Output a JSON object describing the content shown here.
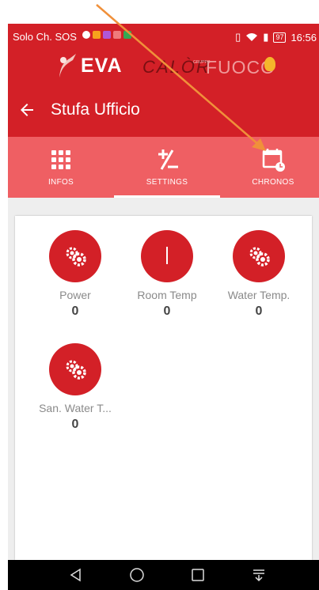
{
  "status": {
    "carrier": "Solo Ch. SOS",
    "battery": "97",
    "time": "16:56"
  },
  "brand": {
    "name_left": "EVA",
    "name_mid": "CALÒR",
    "name_tiny": "GRUPPO",
    "name_right": "FUOCO"
  },
  "header": {
    "title": "Stufa Ufficio",
    "back_icon": "arrow-left"
  },
  "tabs": [
    {
      "label": "INFOS",
      "icon": "grid-dots-icon",
      "selected": false
    },
    {
      "label": "SETTINGS",
      "icon": "plus-minus-icon",
      "selected": true
    },
    {
      "label": "CHRONOS",
      "icon": "calendar-clock-icon",
      "selected": false
    }
  ],
  "tiles": [
    {
      "name": "Power",
      "value": "0",
      "icon": "gears-icon"
    },
    {
      "name": "Room Temp",
      "value": "0",
      "icon": "thermometer-icon"
    },
    {
      "name": "Water Temp.",
      "value": "0",
      "icon": "gears-icon"
    },
    {
      "name": "San. Water T...",
      "value": "0",
      "icon": "gears-icon"
    }
  ],
  "colors": {
    "primary": "#d32027",
    "tab_bar": "#ef5f63",
    "annotation_arrow": "#f0903a"
  }
}
